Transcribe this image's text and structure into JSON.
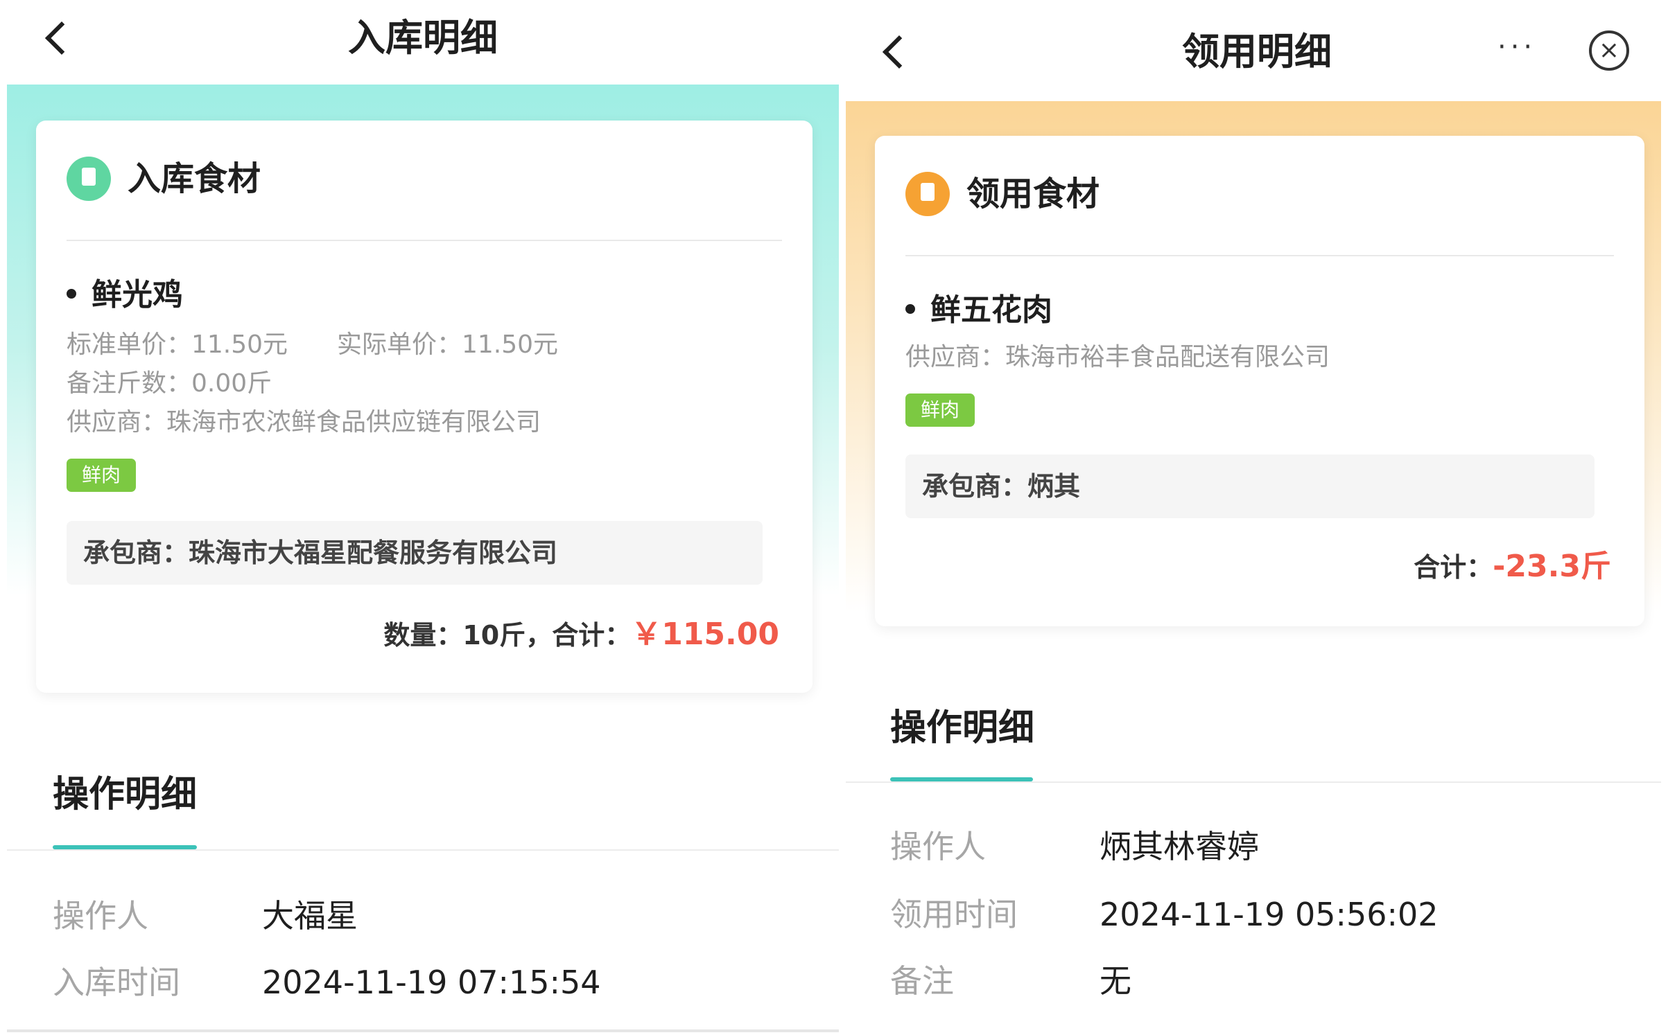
{
  "colors": {
    "left_accent": "#9eeee4",
    "right_accent": "#fbd596",
    "inbound_icon": "#5fd6a1",
    "outbound_icon": "#f6a233",
    "tag_green": "#7cc942",
    "price_red": "#f05a4a",
    "section_underline": "#3cc2b8"
  },
  "icons": {
    "back": "chevron-left-icon",
    "more": "more-dots-icon",
    "close": "close-circle-icon",
    "inbound": "document-in-icon",
    "outbound": "document-out-icon"
  },
  "left": {
    "title": "入库明细",
    "card": {
      "header": "入库食材",
      "item": {
        "name": "鲜光鸡",
        "standard_price": "标准单价：11.50元",
        "actual_price": "实际单价：11.50元",
        "note_weight": "备注斤数：0.00斤",
        "supplier": "供应商：珠海市农浓鲜食品供应链有限公司",
        "tag": "鲜肉",
        "contractor": "承包商：珠海市大福星配餐服务有限公司",
        "total_prefix": "数量：10斤，合计：",
        "total_amount": "￥115.00"
      }
    },
    "section": {
      "title": "操作明细",
      "rows": [
        {
          "label": "操作人",
          "value": "大福星"
        },
        {
          "label": "入库时间",
          "value": "2024-11-19 07:15:54"
        }
      ]
    }
  },
  "right": {
    "title": "领用明细",
    "more_label": "···",
    "close_label": "×",
    "card": {
      "header": "领用食材",
      "item": {
        "name": "鲜五花肉",
        "supplier": "供应商：珠海市裕丰食品配送有限公司",
        "tag": "鲜肉",
        "contractor": "承包商：炳其",
        "total_prefix": "合计：",
        "total_amount": "-23.3斤"
      }
    },
    "section": {
      "title": "操作明细",
      "rows": [
        {
          "label": "操作人",
          "value": "炳其林睿婷"
        },
        {
          "label": "领用时间",
          "value": "2024-11-19 05:56:02"
        },
        {
          "label": "备注",
          "value": "无"
        }
      ]
    }
  }
}
